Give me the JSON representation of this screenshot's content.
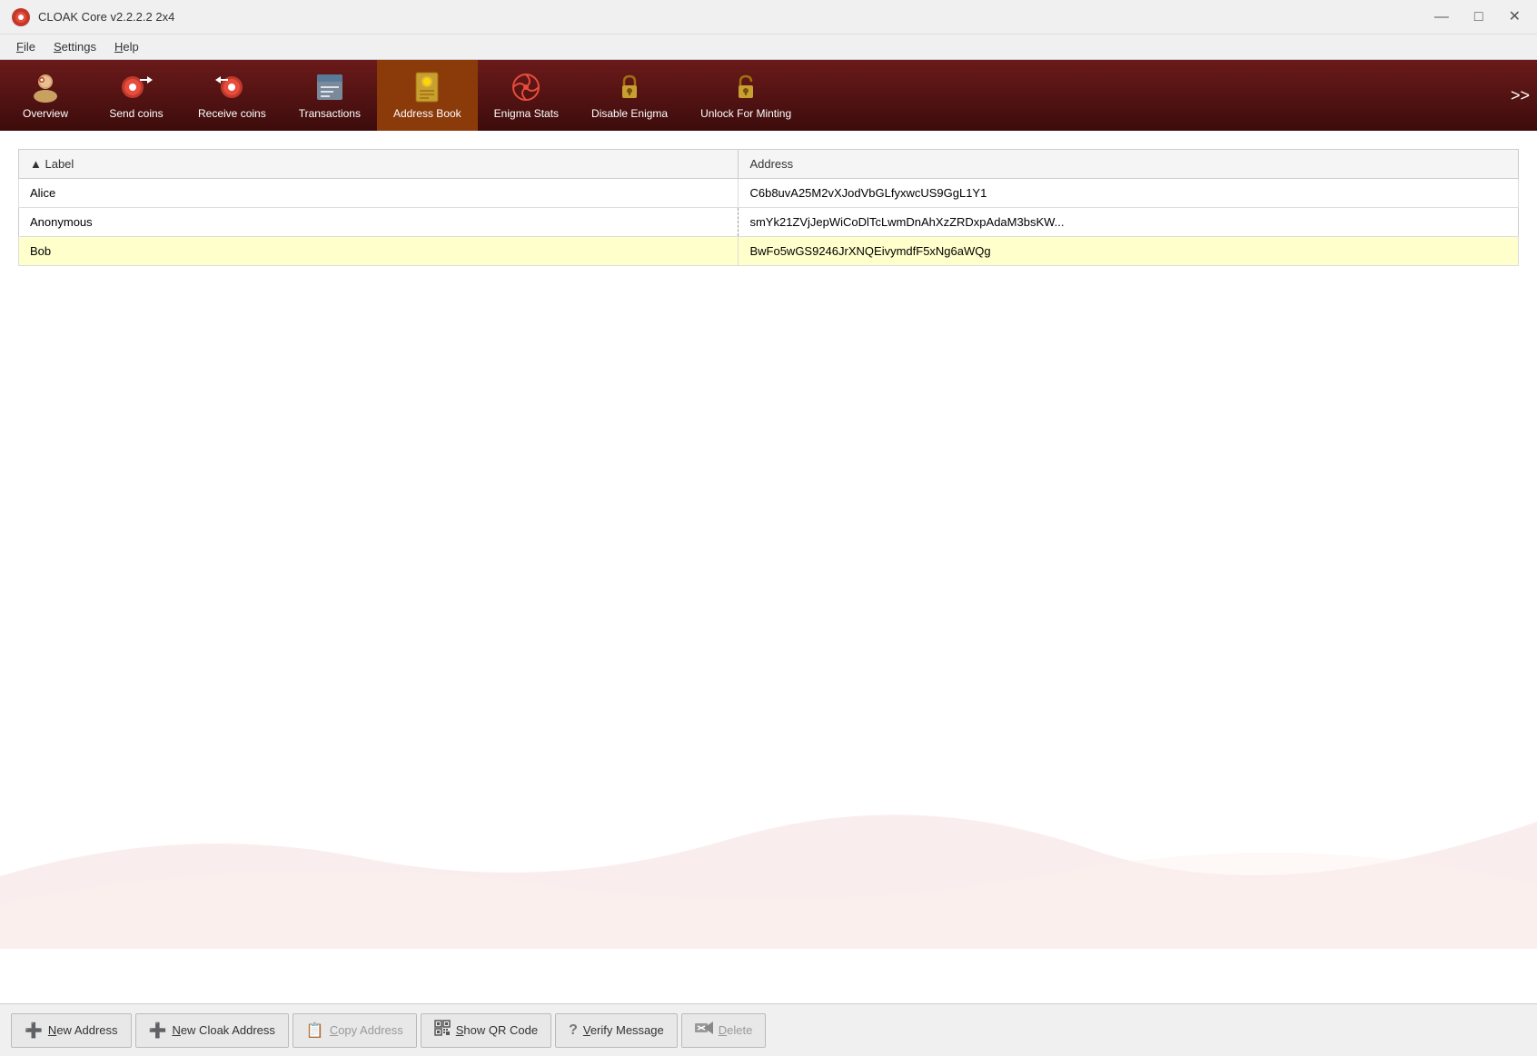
{
  "window": {
    "title": "CLOAK Core v2.2.2.2 2x4",
    "controls": {
      "minimize": "—",
      "maximize": "□",
      "close": "✕"
    }
  },
  "menubar": {
    "items": [
      {
        "id": "file",
        "label": "File",
        "underline_index": 0
      },
      {
        "id": "settings",
        "label": "Settings",
        "underline_index": 0
      },
      {
        "id": "help",
        "label": "Help",
        "underline_index": 0
      }
    ]
  },
  "toolbar": {
    "buttons": [
      {
        "id": "overview",
        "label": "Overview",
        "icon": "👤"
      },
      {
        "id": "send-coins",
        "label": "Send coins",
        "icon": "🔴"
      },
      {
        "id": "receive-coins",
        "label": "Receive coins",
        "icon": "🔴"
      },
      {
        "id": "transactions",
        "label": "Transactions",
        "icon": "📋"
      },
      {
        "id": "address-book",
        "label": "Address Book",
        "icon": "📒",
        "active": true
      },
      {
        "id": "enigma-stats",
        "label": "Enigma Stats",
        "icon": "🌀"
      },
      {
        "id": "disable-enigma",
        "label": "Disable Enigma",
        "icon": "🔒"
      },
      {
        "id": "unlock-minting",
        "label": "Unlock For Minting",
        "icon": "🔒"
      }
    ],
    "overflow": ">>"
  },
  "table": {
    "columns": [
      {
        "id": "label",
        "header": "Label"
      },
      {
        "id": "address",
        "header": "Address"
      }
    ],
    "rows": [
      {
        "label": "Alice",
        "address": "C6b8uvA25M2vXJodVbGLfyxwcUS9GgL1Y1",
        "style": "normal"
      },
      {
        "label": "Anonymous",
        "address": "smYk21ZVjJepWiCoDlTcLwmDnAhXzZRDxpAdaM3bsKW...",
        "style": "yellow"
      },
      {
        "label": "Bob",
        "address": "BwFo5wGS9246JrXNQEivymdfF5xNg6aWQg",
        "style": "normal"
      }
    ]
  },
  "bottom_toolbar": {
    "buttons": [
      {
        "id": "new-address",
        "label": "New Address",
        "icon": "➕",
        "icon_color": "green",
        "enabled": true
      },
      {
        "id": "new-cloak-address",
        "label": "New Cloak Address",
        "icon": "➕",
        "icon_color": "green",
        "enabled": true
      },
      {
        "id": "copy-address",
        "label": "Copy Address",
        "icon": "📋",
        "enabled": false
      },
      {
        "id": "show-qr",
        "label": "Show QR Code",
        "icon": "▦",
        "enabled": true
      },
      {
        "id": "verify-message",
        "label": "Verify Message",
        "icon": "?",
        "enabled": true
      },
      {
        "id": "delete",
        "label": "Delete",
        "icon": "🗑",
        "enabled": false
      }
    ]
  }
}
